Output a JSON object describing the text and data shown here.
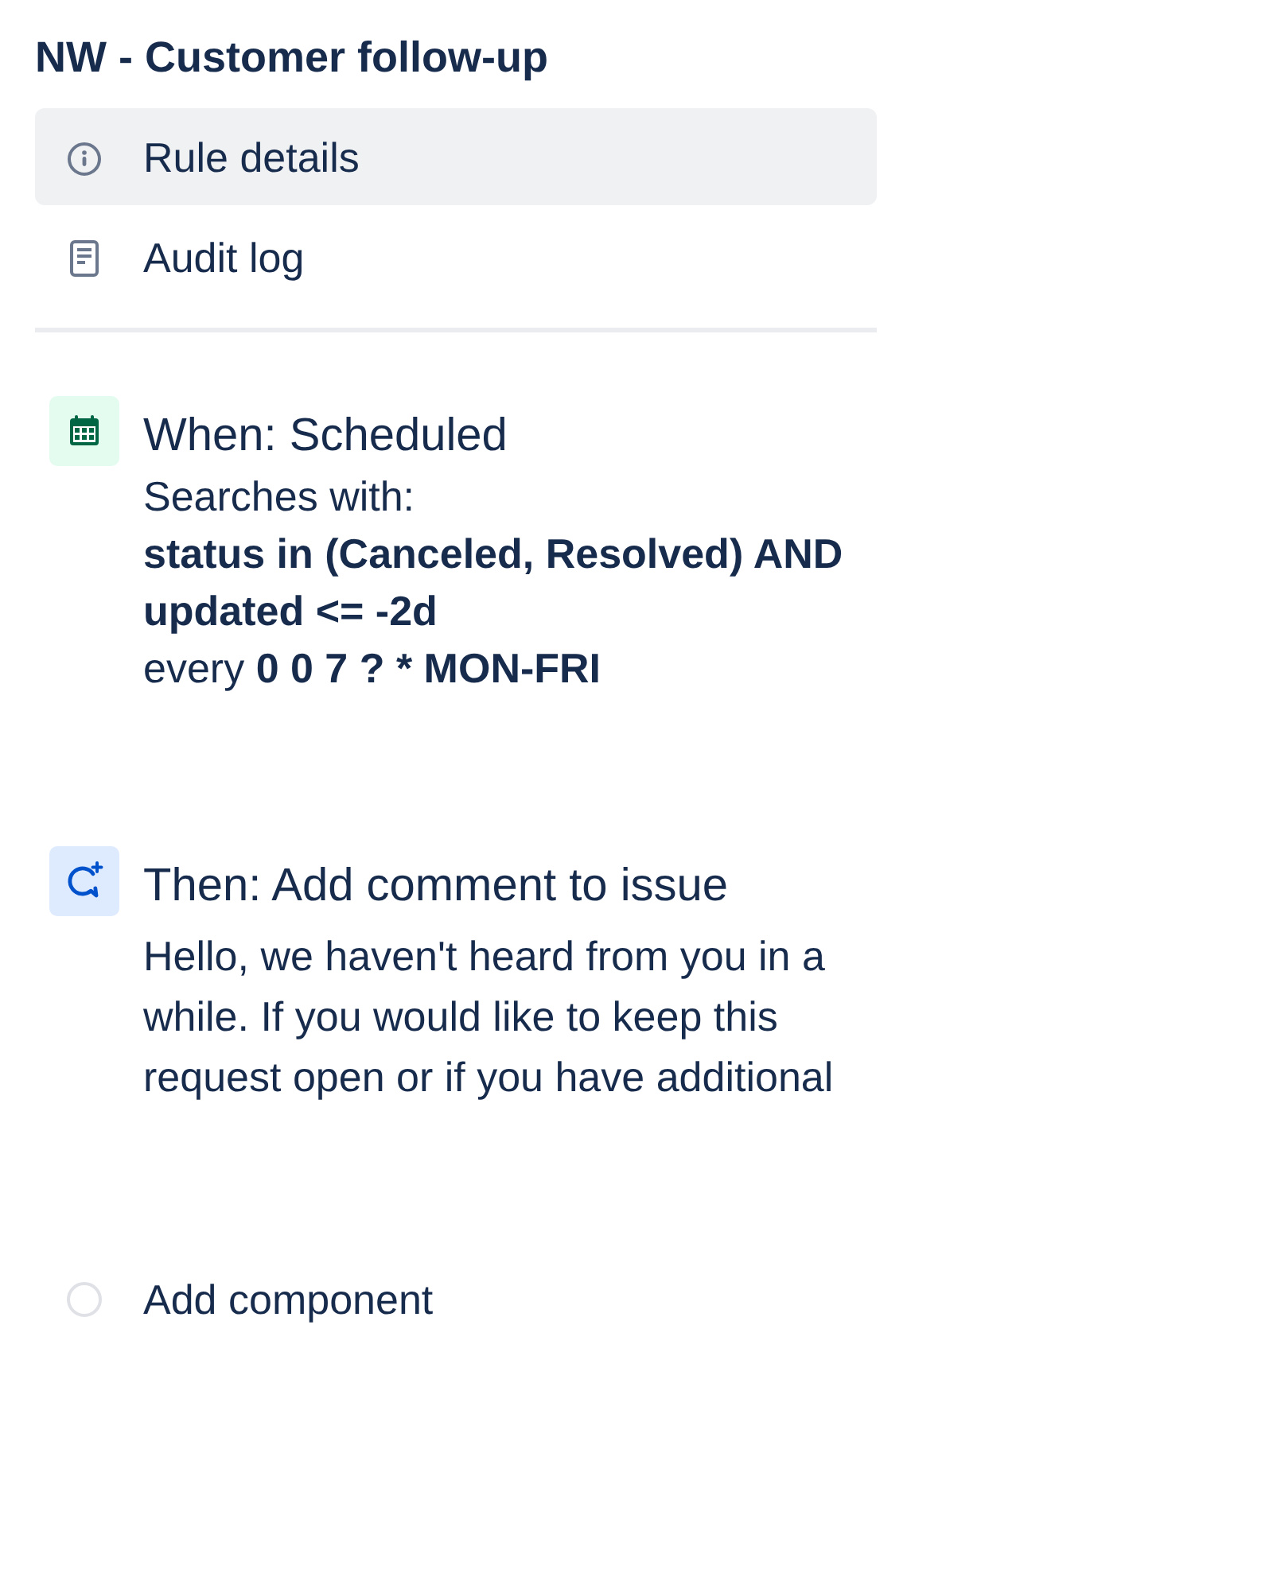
{
  "title": "NW - Customer follow-up",
  "nav": [
    {
      "label": "Rule details",
      "selected": true
    },
    {
      "label": "Audit log",
      "selected": false
    }
  ],
  "components": [
    {
      "kind": "trigger",
      "heading": "When: Scheduled",
      "lines": [
        {
          "text": "Searches with:",
          "bold": false
        },
        {
          "text": "status in (Canceled, Resolved) AND updated <= -2d",
          "bold": true
        },
        {
          "text": "every **0 0 7 ? * MON-FRI**",
          "bold": false
        }
      ]
    },
    {
      "kind": "action",
      "heading": "Then: Add comment to issue",
      "lines": [
        {
          "text": "Hello, we haven't heard from you in a while. If you would like to keep this request open or if you have additional",
          "bold": false
        }
      ]
    }
  ],
  "add_component": {
    "label": "Add component"
  }
}
